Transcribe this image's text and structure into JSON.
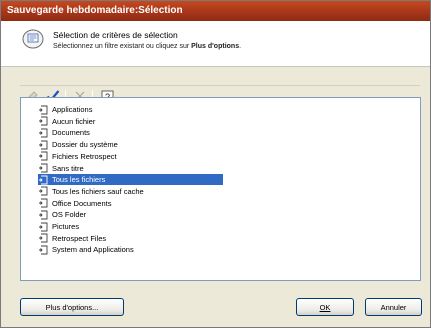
{
  "window": {
    "title": "Sauvegarde hebdomadaire:Sélection"
  },
  "header": {
    "icon": "filter-criteria-icon",
    "title": "Sélection de critères de sélection",
    "description_prefix": "Sélectionnez un filtre existant ou cliquez sur ",
    "description_bold": "Plus d'options",
    "description_suffix": "."
  },
  "toolbar": {
    "buttons": [
      {
        "icon": "edit-filter-icon",
        "state": "disabled"
      },
      {
        "icon": "checkmark-icon",
        "state": "enabled"
      },
      {
        "icon": "delete-x-icon",
        "state": "disabled"
      },
      {
        "icon": "help-icon",
        "state": "enabled"
      }
    ]
  },
  "filters": {
    "items": [
      "Applications",
      "Aucun fichier",
      "Documents",
      "Dossier du système",
      "Fichiers Retrospect",
      "Sans titre",
      "Tous les fichiers",
      "Tous les fichiers sauf cache",
      "Office Documents",
      "OS Folder",
      "Pictures",
      "Retrospect Files",
      "System and Applications"
    ],
    "selected": "Tous les fichiers"
  },
  "buttons": {
    "more_options": "Plus d'options...",
    "ok": "OK",
    "cancel": "Annuler"
  },
  "colors": {
    "titlebar": "#a7361a",
    "selection": "#316ac5",
    "check": "#1f4fc7"
  }
}
